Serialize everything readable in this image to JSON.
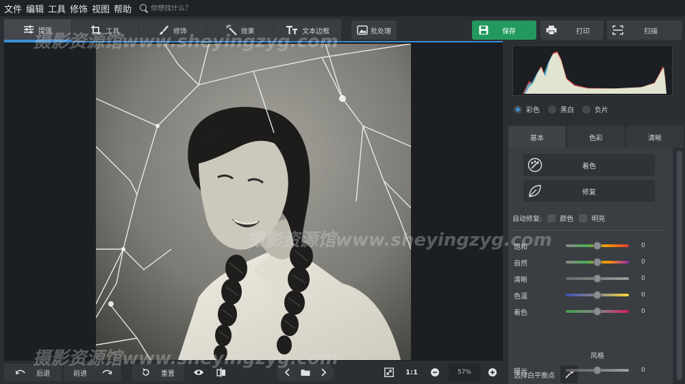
{
  "menubar": {
    "items": [
      "文件",
      "编辑",
      "工具",
      "修饰",
      "视图",
      "帮助"
    ],
    "search_placeholder": "你想找什么？"
  },
  "toolbar": {
    "tabs": [
      {
        "label": "增强",
        "icon": "sliders-icon"
      },
      {
        "label": "工具",
        "icon": "crop-icon"
      },
      {
        "label": "修饰",
        "icon": "brush-icon"
      },
      {
        "label": "效果",
        "icon": "magic-wand-icon"
      },
      {
        "label": "文本边框",
        "icon": "text-icon"
      }
    ],
    "batch": "批处理",
    "save": "保存",
    "print": "打印",
    "scan": "扫描",
    "accent": "#3d8fd6",
    "save_color": "#229a5e"
  },
  "bottombar": {
    "undo": "后退",
    "redo": "前进",
    "reset": "重置",
    "fit_label": "1:1",
    "zoom": "57%"
  },
  "panel": {
    "modes": [
      "彩色",
      "黑白",
      "负片"
    ],
    "tabs": [
      "基本",
      "色彩",
      "清晰"
    ],
    "colorize": "着色",
    "repair": "修复",
    "autofix_label": "自动修复:",
    "autofix_color": "颜色",
    "autofix_bright": "明亮",
    "sliders": [
      {
        "label": "饱和",
        "value": "0",
        "level": 0.5
      },
      {
        "label": "自然",
        "value": "0",
        "level": 0.5
      },
      {
        "label": "清晰",
        "value": "0",
        "level": 0.5
      },
      {
        "label": "色温",
        "value": "0",
        "level": 0.5
      },
      {
        "label": "着色",
        "value": "0",
        "level": 0.5
      }
    ],
    "white_balance": "选择白平衡点",
    "style_title": "风格",
    "exposure": {
      "label": "曝光",
      "value": "0",
      "level": 0.5
    }
  },
  "watermark": "摄影资源馆www.sheyingzyg.com"
}
